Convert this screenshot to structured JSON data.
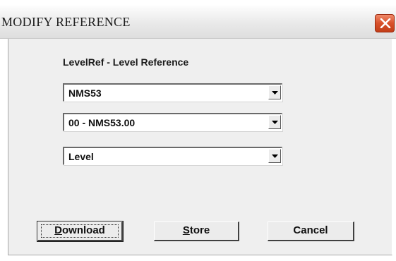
{
  "window": {
    "title": "MODIFY REFERENCE",
    "close_icon": "close-x-icon",
    "close_color": "#d24a22"
  },
  "form": {
    "heading": "LevelRef - Level Reference",
    "combos": [
      {
        "value": "NMS53"
      },
      {
        "value": "00 - NMS53.00"
      },
      {
        "value": "Level"
      }
    ]
  },
  "buttons": {
    "download": {
      "mnemonic": "D",
      "rest": "ownload"
    },
    "store": {
      "mnemonic": "S",
      "rest": "tore"
    },
    "cancel": {
      "label": "Cancel"
    }
  }
}
